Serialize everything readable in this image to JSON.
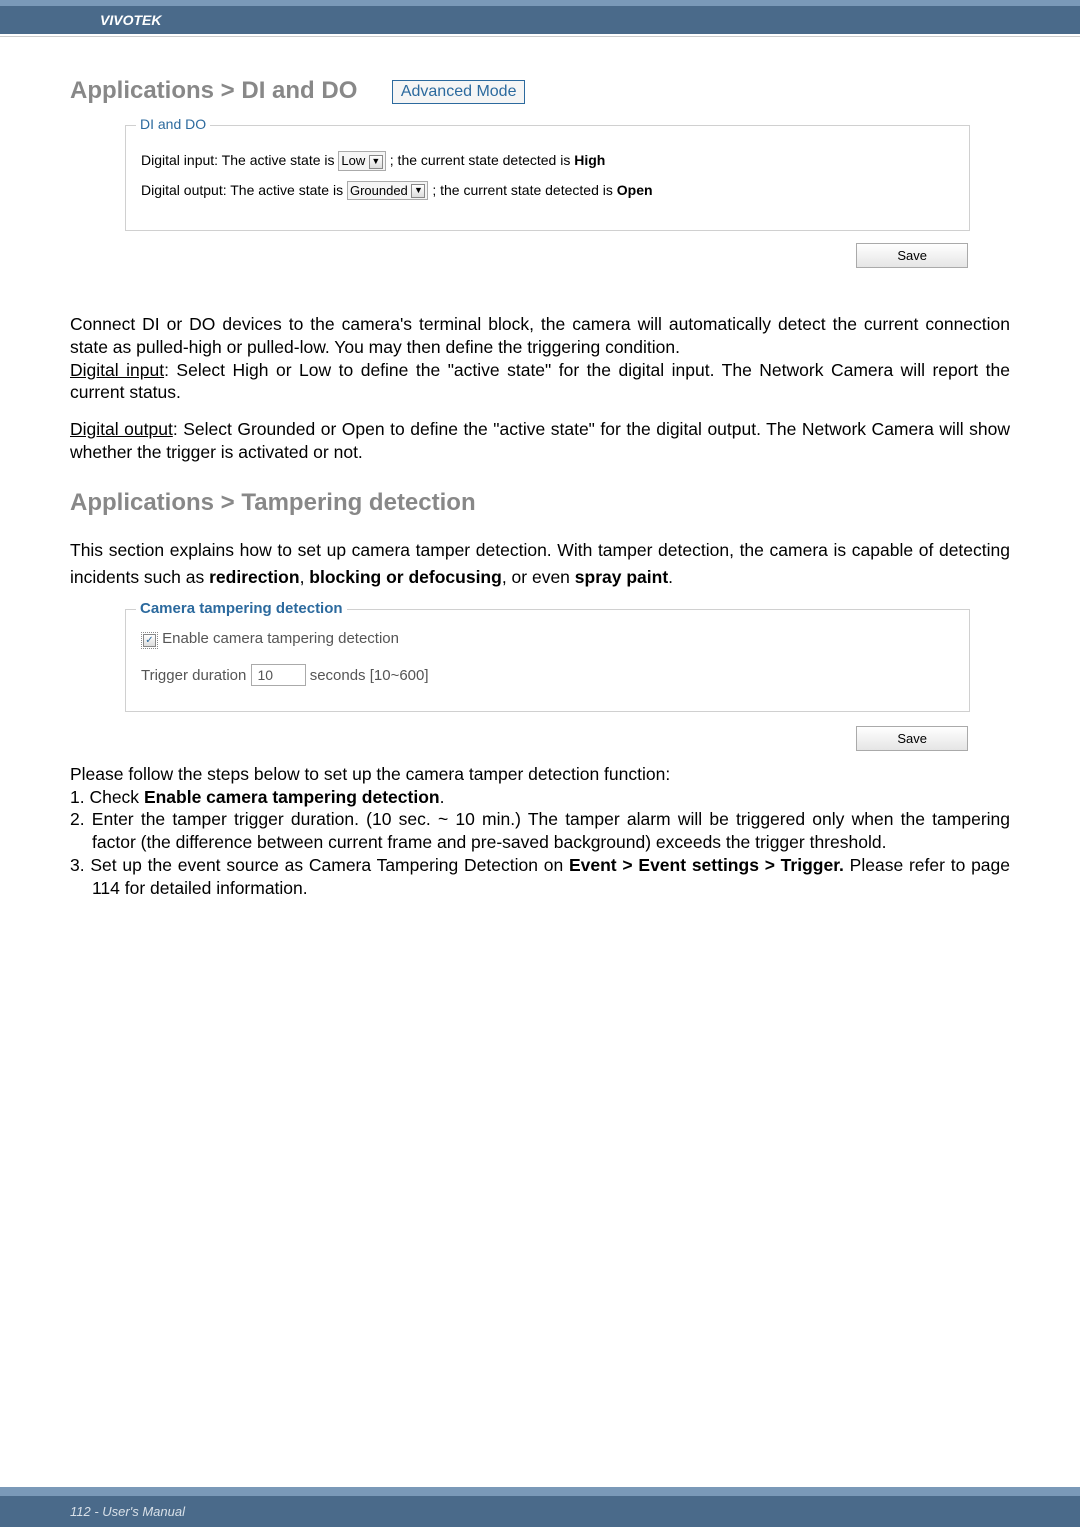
{
  "header": {
    "brand": "VIVOTEK"
  },
  "section1": {
    "title": "Applications > DI and DO",
    "badge": "Advanced Mode"
  },
  "fieldset_di": {
    "legend": "DI and DO",
    "row1_prefix": "Digital input: The active state is",
    "row1_select": "Low",
    "row1_suffix_a": " ; the current state detected is ",
    "row1_suffix_b": "High",
    "row2_prefix": "Digital output: The active state is",
    "row2_select": "Grounded",
    "row2_suffix_a": " ; the current state detected is ",
    "row2_suffix_b": "Open",
    "save": "Save"
  },
  "para1": "Connect DI or DO devices to the camera's terminal block, the camera will automatically detect the current connection state as pulled-high or pulled-low. You may then define the triggering condition.",
  "para2a": "Digital input",
  "para2b": ": Select High or Low to define the \"active state\" for the digital input. The Network Camera will report the current status.",
  "para3a": "Digital output",
  "para3b": ": Select Grounded or Open to define the \"active state\" for the digital output. The Network Camera will show whether the trigger is activated or not.",
  "section2": {
    "title": "Applications > Tampering detection"
  },
  "para4a": "This section explains how to set up camera tamper detection. With tamper detection, the camera is capable of detecting incidents such as ",
  "para4b": "redirection",
  "para4c": ", ",
  "para4d": "blocking or defocusing",
  "para4e": ", or even ",
  "para4f": "spray paint",
  "para4g": ".",
  "fieldset_tamper": {
    "legend": "Camera tampering detection",
    "checkbox_label": " Enable camera tampering detection",
    "trigger_label": "Trigger duration",
    "trigger_value": "10",
    "trigger_suffix": "seconds [10~600]",
    "save": "Save"
  },
  "steps": {
    "intro": "Please follow the steps below to set up the camera tamper detection function:",
    "s1a": "1. Check ",
    "s1b": "Enable camera tampering detection",
    "s1c": ".",
    "s2": "2. Enter the tamper trigger duration. (10 sec. ~ 10 min.) The tamper alarm will be triggered only when the tampering factor (the difference between current frame and pre-saved background) exceeds the trigger threshold.",
    "s3a": "3. Set up the event source as Camera Tampering Detection on ",
    "s3b": "Event > Event settings > Trigger.",
    "s3c": " Please refer to page 114 for detailed information."
  },
  "footer": {
    "text": "112 - User's Manual"
  }
}
